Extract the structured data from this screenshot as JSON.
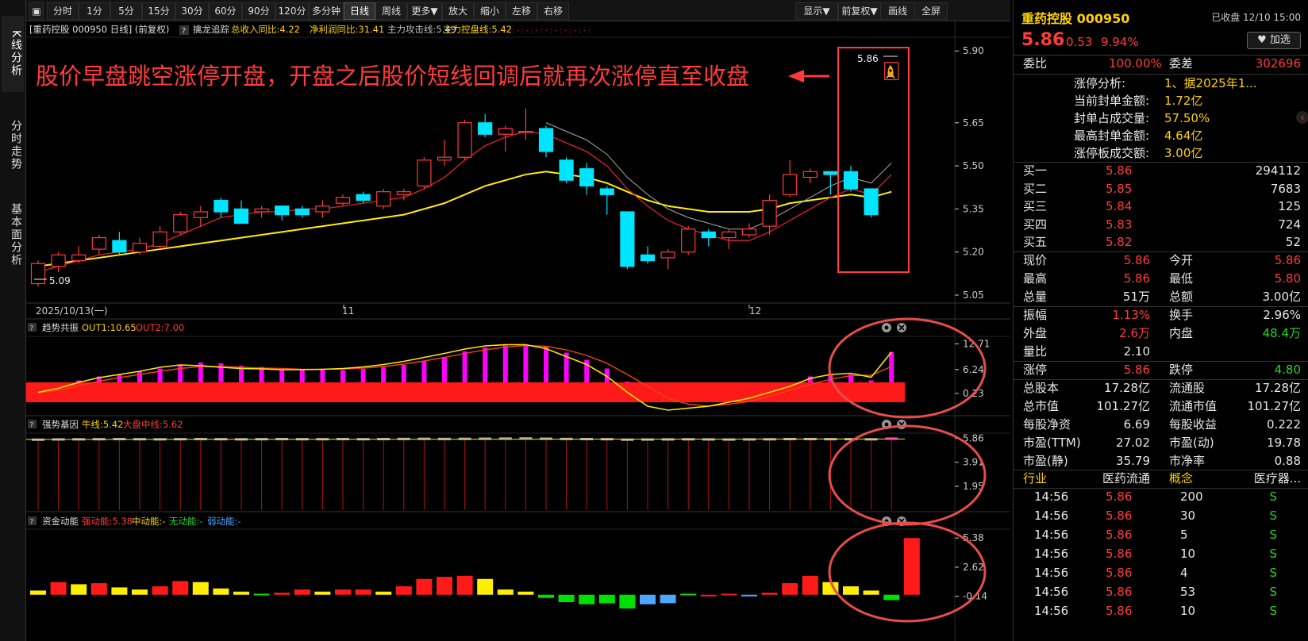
{
  "left_tabs": [
    "K线分析",
    "分时走势",
    "基本面分析"
  ],
  "toolbar": {
    "items": [
      "分时",
      "1分",
      "5分",
      "15分",
      "30分",
      "60分",
      "90分",
      "120分",
      "多分钟",
      "日线",
      "周线",
      "更多▼",
      "放大",
      "缩小",
      "左移",
      "右移"
    ],
    "active": "日线",
    "right_items": [
      "显示▼",
      "前复权▼",
      "画线",
      "全屏"
    ]
  },
  "main_header": {
    "title": "[重药控股 000950 日线] (前复权)",
    "indicator": "擒龙追踪",
    "f1": "总收入同比:4.22",
    "f2": "净利润同比:31.41",
    "f3": "主力攻击线:5.49",
    "f4": "主力控盘线:5.42"
  },
  "annotation": "股价早盘跳空涨停开盘，开盘之后股价短线回调后就再次涨停直至收盘",
  "main_axis": [
    "5.90",
    "5.65",
    "5.50",
    "5.35",
    "5.20",
    "5.05"
  ],
  "price_high_label": "5.86",
  "price_low_label": "5.09",
  "date_labels": [
    "2025/10/13(一)",
    "11",
    "12"
  ],
  "panel1": {
    "name": "趋势共振",
    "out1": "OUT1:10.65",
    "out2": "OUT2:7.00",
    "axis": [
      "12.71",
      "6.24",
      "0.23"
    ]
  },
  "panel2": {
    "name": "强势基因",
    "s1": "牛线:5.42",
    "s2": "大盘中线:5.62",
    "axis": [
      "5.86",
      "3.91",
      "1.95"
    ]
  },
  "panel3": {
    "name": "资金动能",
    "s1": "强动能:5.38",
    "s2": "中动能:-",
    "s3": "无动能:-",
    "s4": "弱动能:-",
    "axis": [
      "5.38",
      "2.62",
      "-0.14"
    ]
  },
  "colors": {
    "up": "#ff3b3b",
    "down": "#00e5ff",
    "ma_yellow": "#ffee00",
    "magenta": "#ff00ff",
    "circle": "#e84c4c"
  },
  "chart_data": [
    {
      "type": "candlestick",
      "title": "重药控股 000950 日线",
      "ylim": [
        5.05,
        5.92
      ],
      "candles": [
        {
          "o": 5.09,
          "h": 5.17,
          "l": 5.08,
          "c": 5.16
        },
        {
          "o": 5.15,
          "h": 5.2,
          "l": 5.13,
          "c": 5.19
        },
        {
          "o": 5.17,
          "h": 5.22,
          "l": 5.16,
          "c": 5.19
        },
        {
          "o": 5.21,
          "h": 5.26,
          "l": 5.19,
          "c": 5.25
        },
        {
          "o": 5.24,
          "h": 5.27,
          "l": 5.19,
          "c": 5.2
        },
        {
          "o": 5.2,
          "h": 5.25,
          "l": 5.19,
          "c": 5.23
        },
        {
          "o": 5.22,
          "h": 5.29,
          "l": 5.21,
          "c": 5.27
        },
        {
          "o": 5.27,
          "h": 5.34,
          "l": 5.26,
          "c": 5.33
        },
        {
          "o": 5.32,
          "h": 5.36,
          "l": 5.29,
          "c": 5.34
        },
        {
          "o": 5.38,
          "h": 5.39,
          "l": 5.32,
          "c": 5.34
        },
        {
          "o": 5.35,
          "h": 5.38,
          "l": 5.31,
          "c": 5.3
        },
        {
          "o": 5.34,
          "h": 5.36,
          "l": 5.32,
          "c": 5.35
        },
        {
          "o": 5.36,
          "h": 5.36,
          "l": 5.31,
          "c": 5.33
        },
        {
          "o": 5.35,
          "h": 5.36,
          "l": 5.32,
          "c": 5.33
        },
        {
          "o": 5.34,
          "h": 5.38,
          "l": 5.32,
          "c": 5.36
        },
        {
          "o": 5.37,
          "h": 5.4,
          "l": 5.36,
          "c": 5.39
        },
        {
          "o": 5.4,
          "h": 5.41,
          "l": 5.37,
          "c": 5.38
        },
        {
          "o": 5.36,
          "h": 5.42,
          "l": 5.35,
          "c": 5.41
        },
        {
          "o": 5.4,
          "h": 5.42,
          "l": 5.38,
          "c": 5.41
        },
        {
          "o": 5.43,
          "h": 5.53,
          "l": 5.42,
          "c": 5.52
        },
        {
          "o": 5.52,
          "h": 5.59,
          "l": 5.5,
          "c": 5.53
        },
        {
          "o": 5.53,
          "h": 5.66,
          "l": 5.52,
          "c": 5.65
        },
        {
          "o": 5.65,
          "h": 5.68,
          "l": 5.6,
          "c": 5.61
        },
        {
          "o": 5.61,
          "h": 5.64,
          "l": 5.55,
          "c": 5.63
        },
        {
          "o": 5.62,
          "h": 5.7,
          "l": 5.59,
          "c": 5.62
        },
        {
          "o": 5.63,
          "h": 5.64,
          "l": 5.53,
          "c": 5.55
        },
        {
          "o": 5.52,
          "h": 5.53,
          "l": 5.44,
          "c": 5.45
        },
        {
          "o": 5.49,
          "h": 5.51,
          "l": 5.4,
          "c": 5.43
        },
        {
          "o": 5.42,
          "h": 5.43,
          "l": 5.33,
          "c": 5.4
        },
        {
          "o": 5.34,
          "h": 5.34,
          "l": 5.14,
          "c": 5.15
        },
        {
          "o": 5.19,
          "h": 5.22,
          "l": 5.16,
          "c": 5.17
        },
        {
          "o": 5.18,
          "h": 5.21,
          "l": 5.14,
          "c": 5.2
        },
        {
          "o": 5.2,
          "h": 5.29,
          "l": 5.19,
          "c": 5.28
        },
        {
          "o": 5.27,
          "h": 5.28,
          "l": 5.22,
          "c": 5.25
        },
        {
          "o": 5.25,
          "h": 5.28,
          "l": 5.21,
          "c": 5.27
        },
        {
          "o": 5.26,
          "h": 5.3,
          "l": 5.25,
          "c": 5.28
        },
        {
          "o": 5.29,
          "h": 5.4,
          "l": 5.26,
          "c": 5.38
        },
        {
          "o": 5.4,
          "h": 5.52,
          "l": 5.39,
          "c": 5.47
        },
        {
          "o": 5.46,
          "h": 5.49,
          "l": 5.44,
          "c": 5.48
        },
        {
          "o": 5.48,
          "h": 5.48,
          "l": 5.4,
          "c": 5.47
        },
        {
          "o": 5.48,
          "h": 5.5,
          "l": 5.41,
          "c": 5.42
        },
        {
          "o": 5.42,
          "h": 5.42,
          "l": 5.32,
          "c": 5.33
        },
        {
          "o": 5.8,
          "h": 5.86,
          "l": 5.8,
          "c": 5.86
        }
      ],
      "ma_short": [
        5.13,
        5.15,
        5.17,
        5.19,
        5.2,
        5.21,
        5.23,
        5.26,
        5.29,
        5.32,
        5.33,
        5.34,
        5.34,
        5.35,
        5.35,
        5.36,
        5.37,
        5.38,
        5.39,
        5.42,
        5.46,
        5.52,
        5.57,
        5.6,
        5.62,
        5.61,
        5.58,
        5.55,
        5.5,
        5.42,
        5.36,
        5.31,
        5.28,
        5.26,
        5.24,
        5.24,
        5.27,
        5.31,
        5.35,
        5.39,
        5.42,
        5.4,
        5.47
      ],
      "ma_long": [
        5.15,
        5.16,
        5.17,
        5.18,
        5.19,
        5.2,
        5.21,
        5.22,
        5.23,
        5.24,
        5.25,
        5.26,
        5.27,
        5.28,
        5.29,
        5.3,
        5.31,
        5.32,
        5.33,
        5.35,
        5.37,
        5.4,
        5.43,
        5.45,
        5.47,
        5.48,
        5.47,
        5.46,
        5.44,
        5.41,
        5.38,
        5.36,
        5.35,
        5.34,
        5.34,
        5.34,
        5.35,
        5.37,
        5.38,
        5.39,
        5.4,
        5.39,
        5.41
      ]
    },
    {
      "type": "bar",
      "title": "趋势共振",
      "ylim": [
        -5,
        14
      ],
      "values": [
        0.5,
        2.0,
        3.5,
        4.5,
        5.0,
        5.8,
        6.5,
        7.5,
        8.0,
        7.8,
        7.2,
        6.9,
        6.5,
        6.3,
        6.2,
        6.1,
        6.4,
        6.8,
        7.4,
        8.3,
        9.2,
        10.8,
        11.8,
        12.3,
        12.4,
        12.0,
        10.5,
        8.7,
        6.5,
        3.2,
        0,
        0,
        0,
        0,
        0,
        0,
        0,
        0,
        4.5,
        5.2,
        5.0,
        3.5,
        10.65
      ],
      "line1": [
        0.5,
        1.5,
        3.0,
        4.2,
        5.0,
        5.8,
        6.8,
        7.4,
        7.2,
        6.8,
        6.5,
        6.4,
        6.2,
        6.2,
        6.3,
        6.5,
        6.9,
        7.5,
        8.3,
        9.3,
        10.3,
        11.4,
        12.2,
        12.5,
        12.5,
        11.5,
        9.5,
        7.5,
        4.5,
        0.5,
        -3.0,
        -4.0,
        -3.5,
        -3.0,
        -2.0,
        -1.0,
        0.5,
        2.0,
        4.0,
        5.0,
        5.3,
        4.3,
        10.65
      ],
      "line2": [
        0.3,
        1.0,
        2.2,
        3.3,
        4.2,
        5.0,
        5.8,
        6.5,
        7.0,
        7.0,
        6.8,
        6.6,
        6.5,
        6.3,
        6.3,
        6.4,
        6.6,
        7.0,
        7.6,
        8.4,
        9.3,
        10.3,
        11.2,
        11.9,
        12.3,
        12.1,
        11.2,
        9.8,
        7.8,
        5.0,
        2.0,
        -1.0,
        -2.5,
        -3.0,
        -2.5,
        -1.8,
        -0.5,
        1.0,
        2.5,
        3.8,
        4.7,
        4.8,
        7.0
      ]
    },
    {
      "type": "bar",
      "title": "强势基因",
      "ylim": [
        0,
        6.1
      ],
      "values": [
        5.76,
        5.78,
        5.79,
        5.8,
        5.81,
        5.8,
        5.79,
        5.8,
        5.81,
        5.8,
        5.79,
        5.8,
        5.81,
        5.8,
        5.8,
        5.81,
        5.8,
        5.81,
        5.82,
        5.83,
        5.82,
        5.83,
        5.84,
        5.85,
        5.86,
        5.84,
        5.82,
        5.81,
        5.8,
        5.76,
        5.77,
        5.78,
        5.79,
        5.78,
        5.77,
        5.78,
        5.79,
        5.81,
        5.81,
        5.8,
        5.8,
        5.79,
        5.86
      ]
    },
    {
      "type": "bar",
      "title": "资金动能",
      "ylim": [
        -1.3,
        6.0
      ],
      "values": [
        0.4,
        1.2,
        1.0,
        1.1,
        0.7,
        0.5,
        0.8,
        1.3,
        1.2,
        0.6,
        0.3,
        0.1,
        0.2,
        0.5,
        0.3,
        0.5,
        0.5,
        0.3,
        0.8,
        1.5,
        1.7,
        1.8,
        1.5,
        0.5,
        0.3,
        -0.3,
        -0.7,
        -0.9,
        -0.8,
        -1.3,
        -0.9,
        -0.8,
        0.1,
        -0.1,
        0.1,
        -0.15,
        0.2,
        1.1,
        1.8,
        1.2,
        0.8,
        0.4,
        -0.5,
        5.38
      ],
      "colors": [
        "y",
        "r",
        "y",
        "r",
        "y",
        "y",
        "r",
        "r",
        "y",
        "y",
        "y",
        "g",
        "r",
        "r",
        "y",
        "r",
        "r",
        "y",
        "r",
        "r",
        "r",
        "r",
        "y",
        "y",
        "y",
        "g",
        "g",
        "g",
        "g",
        "g",
        "b",
        "b",
        "g",
        "r",
        "r",
        "b",
        "r",
        "r",
        "r",
        "y",
        "y",
        "y",
        "g",
        "r"
      ]
    }
  ],
  "right": {
    "stock": "重药控股 000950",
    "status": "已收盘 12/10 15:00",
    "price": "5.86",
    "chg": "0.53",
    "pct": "9.94%",
    "watch": "加选",
    "weibi_label": "委比",
    "weibi": "100.00%",
    "weicha_label": "委差",
    "weicha": "302696",
    "zt_items": [
      {
        "label": "涨停分析:",
        "value": "1、据2025年1..."
      },
      {
        "label": "当前封单金额:",
        "value": "1.72亿"
      },
      {
        "label": "封单占成交量:",
        "value": "57.50%"
      },
      {
        "label": "最高封单金额:",
        "value": "4.64亿"
      },
      {
        "label": "涨停板成交额:",
        "value": "3.00亿"
      }
    ],
    "buys": [
      {
        "label": "买一",
        "price": "5.86",
        "vol": "294112"
      },
      {
        "label": "买二",
        "price": "5.85",
        "vol": "7683"
      },
      {
        "label": "买三",
        "price": "5.84",
        "vol": "125"
      },
      {
        "label": "买四",
        "price": "5.83",
        "vol": "724"
      },
      {
        "label": "买五",
        "price": "5.82",
        "vol": "52"
      }
    ],
    "stats1": [
      {
        "l1": "现价",
        "v1": "5.86",
        "c1": "red",
        "l2": "今开",
        "v2": "5.86",
        "c2": "red"
      },
      {
        "l1": "最高",
        "v1": "5.86",
        "c1": "red",
        "l2": "最低",
        "v2": "5.80",
        "c2": "red"
      },
      {
        "l1": "总量",
        "v1": "51万",
        "c1": "white",
        "l2": "总额",
        "v2": "3.00亿",
        "c2": "white"
      }
    ],
    "stats2": [
      {
        "l1": "振幅",
        "v1": "1.13%",
        "c1": "red",
        "l2": "换手",
        "v2": "2.96%",
        "c2": "white"
      },
      {
        "l1": "外盘",
        "v1": "2.6万",
        "c1": "red",
        "l2": "内盘",
        "v2": "48.4万",
        "c2": "green"
      },
      {
        "l1": "量比",
        "v1": "2.10",
        "c1": "white",
        "l2": "",
        "v2": "",
        "c2": "white"
      }
    ],
    "stats3": [
      {
        "l1": "涨停",
        "v1": "5.86",
        "c1": "red",
        "l2": "跌停",
        "v2": "4.80",
        "c2": "green"
      }
    ],
    "stats4": [
      {
        "l1": "总股本",
        "v1": "17.28亿",
        "c1": "white",
        "l2": "流通股",
        "v2": "17.28亿",
        "c2": "white"
      },
      {
        "l1": "总市值",
        "v1": "101.27亿",
        "c1": "white",
        "l2": "流通市值",
        "v2": "101.27亿",
        "c2": "white"
      },
      {
        "l1": "每股净资",
        "v1": "6.69",
        "c1": "white",
        "l2": "每股收益",
        "v2": "0.222",
        "c2": "white"
      },
      {
        "l1": "市盈(TTM)",
        "v1": "27.02",
        "c1": "white",
        "l2": "市盈(动)",
        "v2": "19.78",
        "c2": "white"
      },
      {
        "l1": "市盈(静)",
        "v1": "35.79",
        "c1": "white",
        "l2": "市净率",
        "v2": "0.88",
        "c2": "white"
      }
    ],
    "industry_label": "行业",
    "industry": "医药流通",
    "concept_label": "概念",
    "concept": "医疗器...",
    "ticks": [
      {
        "t": "14:56",
        "p": "5.86",
        "v": "200",
        "d": "S"
      },
      {
        "t": "14:56",
        "p": "5.86",
        "v": "30",
        "d": "S"
      },
      {
        "t": "14:56",
        "p": "5.86",
        "v": "5",
        "d": "S"
      },
      {
        "t": "14:56",
        "p": "5.86",
        "v": "10",
        "d": "S"
      },
      {
        "t": "14:56",
        "p": "5.86",
        "v": "4",
        "d": "S"
      },
      {
        "t": "14:56",
        "p": "5.86",
        "v": "53",
        "d": "S"
      },
      {
        "t": "14:56",
        "p": "5.86",
        "v": "10",
        "d": "S"
      }
    ]
  }
}
